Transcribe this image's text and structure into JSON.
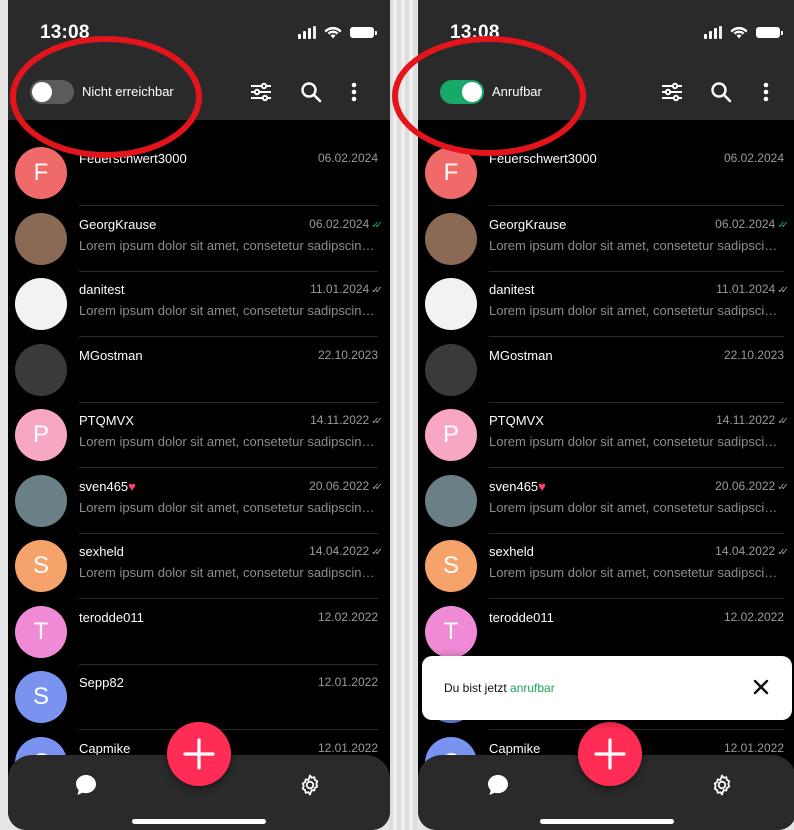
{
  "status_bar": {
    "time": "13:08"
  },
  "left_screen": {
    "toggle_label": "Nicht erreichbar",
    "toggle_on": false
  },
  "right_screen": {
    "toggle_label": "Anrufbar",
    "toggle_on": true,
    "toast": {
      "prefix": "Du bist jetzt ",
      "accent_word": "anrufbar"
    }
  },
  "toolbar": {
    "icons": [
      "filter-sliders-icon",
      "search-icon",
      "more-vert-icon"
    ]
  },
  "chats": [
    {
      "name": "Feuerschwert3000",
      "date": "06.02.2024",
      "preview": "",
      "avatar_letter": "F",
      "avatar_color": "#f06a6a",
      "check": false,
      "heart": false
    },
    {
      "name": "GeorgKrause",
      "date": "06.02.2024",
      "preview": "Lorem ipsum dolor sit amet, consetetur sadipscing elitr",
      "avatar_letter": "",
      "avatar_color": "#8a6a55",
      "check": true,
      "check_color": "#22a35a",
      "heart": false
    },
    {
      "name": "danitest",
      "date": "11.01.2024",
      "preview": "Lorem ipsum dolor sit amet, consetetur sadipscing elitr",
      "avatar_letter": "",
      "avatar_color": "#f2f2f2",
      "check": true,
      "check_color": "#9a9a9a",
      "heart": false
    },
    {
      "name": "MGostman",
      "date": "22.10.2023",
      "preview": "",
      "avatar_letter": "",
      "avatar_color": "#3a3a3a",
      "check": false,
      "heart": false
    },
    {
      "name": "PTQMVX",
      "date": "14.11.2022",
      "preview": "Lorem ipsum dolor sit amet, consetetur sadipscing elitr",
      "avatar_letter": "P",
      "avatar_color": "#f7a6c4",
      "check": true,
      "check_color": "#9a9a9a",
      "heart": false
    },
    {
      "name": "sven465",
      "date": "20.06.2022",
      "preview": "Lorem ipsum dolor sit amet, consetetur sadipscing elitr",
      "avatar_letter": "",
      "avatar_color": "#6a7f86",
      "check": true,
      "check_color": "#9a9a9a",
      "heart": true
    },
    {
      "name": "sexheld",
      "date": "14.04.2022",
      "preview": "Lorem ipsum dolor sit amet, consetetur sadipscing elitr",
      "avatar_letter": "S",
      "avatar_color": "#f5a36b",
      "check": true,
      "check_color": "#9a9a9a",
      "heart": false
    },
    {
      "name": "terodde011",
      "date": "12.02.2022",
      "preview": "",
      "avatar_letter": "T",
      "avatar_color": "#f08ad6",
      "check": false,
      "heart": false
    },
    {
      "name": "Sepp82",
      "date": "12.01.2022",
      "preview": "",
      "avatar_letter": "S",
      "avatar_color": "#7b93f0",
      "check": false,
      "heart": false
    },
    {
      "name": "Capmike",
      "date": "12.01.2022",
      "preview": "",
      "avatar_letter": "C",
      "avatar_color": "#7b93f0",
      "check": false,
      "heart": false
    }
  ],
  "bottom_nav": {
    "items": [
      "chat-bubble-icon",
      "settings-gear-icon"
    ]
  },
  "fab_icon": "plus-icon",
  "colors": {
    "accent": "#ff2d55",
    "toggle_on": "#18a86a",
    "annotation": "#e3141b"
  }
}
